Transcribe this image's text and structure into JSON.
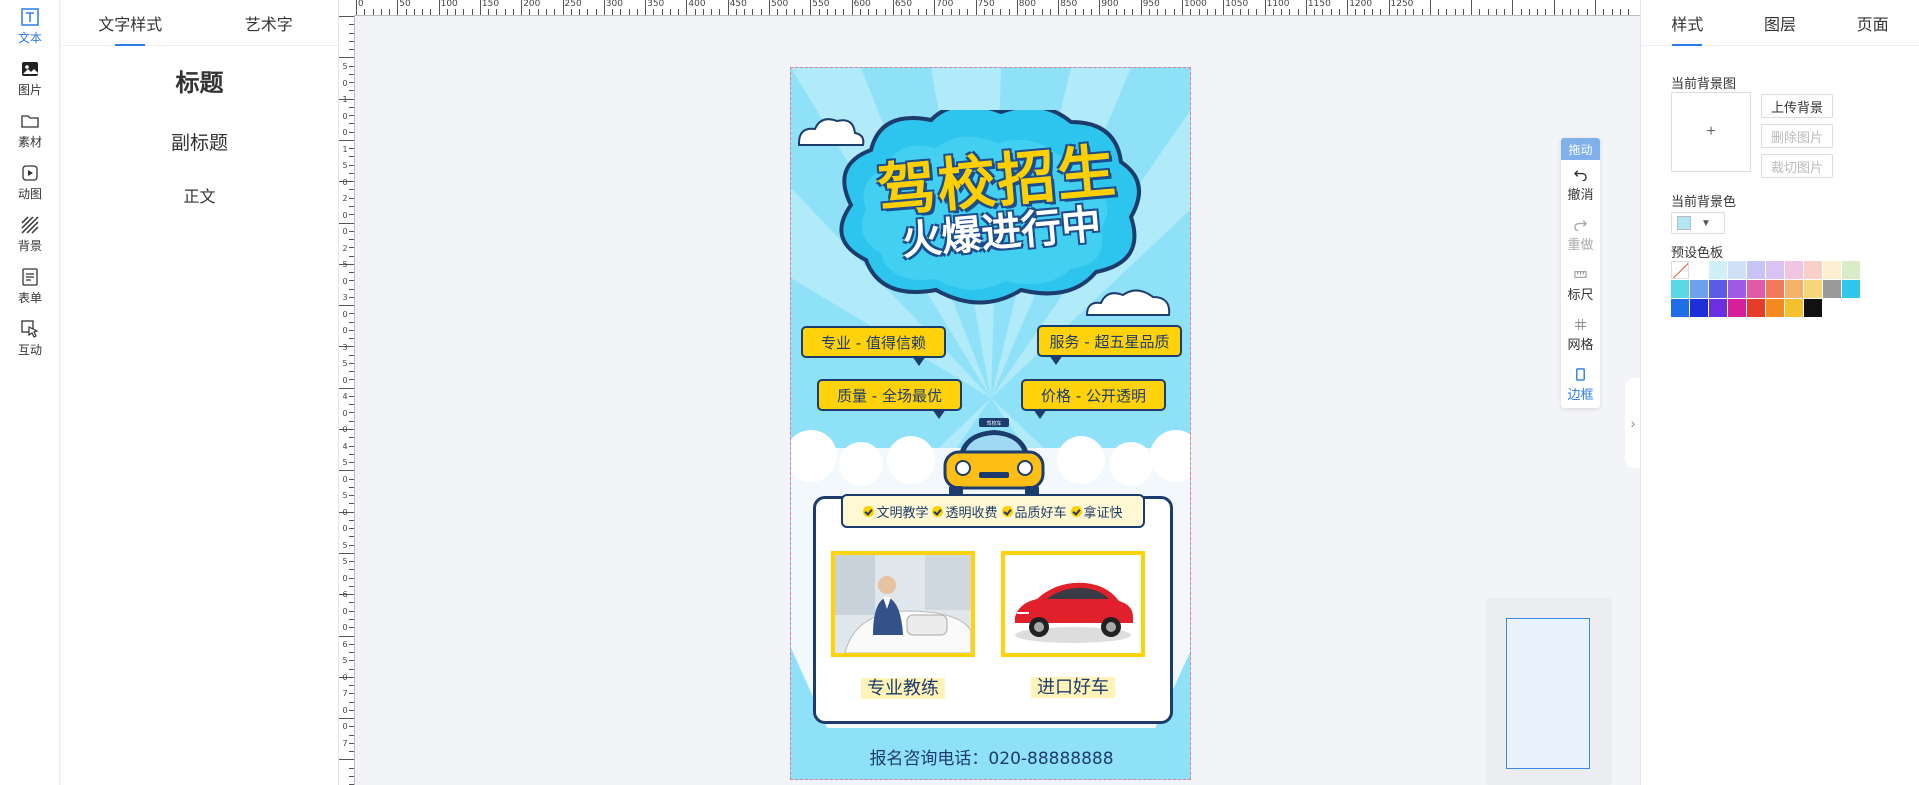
{
  "rail": {
    "items": [
      {
        "label": "文本",
        "icon": "text-icon",
        "active": true
      },
      {
        "label": "图片",
        "icon": "image-icon"
      },
      {
        "label": "素材",
        "icon": "folder-icon"
      },
      {
        "label": "动图",
        "icon": "play-icon"
      },
      {
        "label": "背景",
        "icon": "background-pattern-icon"
      },
      {
        "label": "表单",
        "icon": "form-icon"
      },
      {
        "label": "互动",
        "icon": "interactive-icon"
      }
    ]
  },
  "left_panel": {
    "tabs": [
      {
        "label": "文字样式",
        "active": true
      },
      {
        "label": "艺术字"
      }
    ],
    "presets": {
      "title": "标题",
      "subtitle": "副标题",
      "body": "正文"
    }
  },
  "ruler": {
    "h_labels": [
      "0",
      "50",
      "100",
      "150",
      "200",
      "250",
      "300",
      "350",
      "400",
      "450",
      "500",
      "550",
      "600",
      "650",
      "700",
      "750",
      "800",
      "850",
      "900",
      "950",
      "1000",
      "1050",
      "1100",
      "1150",
      "1200",
      "1250"
    ],
    "v_labels": [
      "5",
      "0",
      "1",
      "0",
      "0",
      "1",
      "5",
      "0",
      "2",
      "0",
      "0",
      "2",
      "5",
      "0",
      "3",
      "0",
      "0",
      "3",
      "5",
      "0",
      "4",
      "0",
      "0",
      "4",
      "5",
      "0",
      "5",
      "0",
      "0",
      "5",
      "5",
      "0",
      "6",
      "0",
      "0",
      "6",
      "5",
      "0",
      "7",
      "0",
      "0",
      "7"
    ]
  },
  "poster": {
    "headline1": "驾校招生",
    "headline2": "火爆进行中",
    "bubbles": [
      "专业 - 值得信赖",
      "服务 - 超五星品质",
      "质量 - 全场最优",
      "价格 - 公开透明"
    ],
    "taxi_sign": "驾校车",
    "features": [
      "文明教学",
      "透明收费",
      "品质好车",
      "拿证快"
    ],
    "captions": [
      "专业教练",
      "进口好车"
    ],
    "phone": "报名咨询电话：020-88888888",
    "colors": {
      "sky": "#8ee1f7",
      "navy": "#1d3c6e",
      "yellow": "#ffd20a"
    }
  },
  "float_toolbar": {
    "drag": "拖动",
    "buttons": [
      {
        "label": "撤消",
        "icon": "undo-icon"
      },
      {
        "label": "重做",
        "icon": "redo-icon",
        "disabled": true
      },
      {
        "label": "标尺",
        "icon": "ruler-icon"
      },
      {
        "label": "网格",
        "icon": "grid-icon"
      },
      {
        "label": "边框",
        "icon": "border-icon",
        "active": true
      }
    ]
  },
  "right_panel": {
    "tabs": [
      {
        "label": "样式",
        "active": true
      },
      {
        "label": "图层"
      },
      {
        "label": "页面"
      }
    ],
    "bg_image_label": "当前背景图",
    "upload_plus": "+",
    "upload_btn": "上传背景",
    "delete_btn": "删除图片",
    "crop_btn": "裁切图片",
    "bg_color_label": "当前背景色",
    "current_color": "#b3e6f7",
    "palette_label": "预设色板",
    "palette": [
      "none",
      "#ffffff",
      "#d0f0f7",
      "#cfe0f7",
      "#c8c4f5",
      "#d8c4f3",
      "#f1c4e3",
      "#f9cfc7",
      "#fdf0d0",
      "#d8ecc8",
      "#5ad8e3",
      "#6fa0ec",
      "#5c5be6",
      "#9f5ae6",
      "#e05aa5",
      "#f07a5a",
      "#f3b267",
      "#f5d77a",
      "#9a9a9a",
      "#31c6ea",
      "#1f6fe8",
      "#1f2fd8",
      "#6b2ee0",
      "#d81f9a",
      "#e83c2a",
      "#f58a20",
      "#f4c030",
      "#111111"
    ]
  }
}
